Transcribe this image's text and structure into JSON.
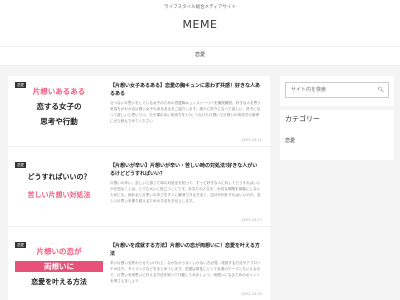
{
  "header": {
    "tagline": "ライフスタイル総合メディアサイト",
    "logo": "MEME"
  },
  "nav": {
    "items": [
      "恋愛"
    ]
  },
  "posts": [
    {
      "category": "恋愛",
      "thumb_lines": [
        "片想いあるある",
        "恋する女子の",
        "思考や行動"
      ],
      "title": "【片想い女子あるある】恋愛の胸キュンに思わず共感！好きな人あるある",
      "snippet": "せつない片思いをしている女子のための恋愛胸キュンストーリーを徹底解説。好きな人を思う気持ちがわかる片想い女子のあるあるをご紹介します。誰かに好きになって欲しい、好きになって欲しいと思いつつ、行き場のない気持ちを1つにつなげた片想いで片想いの気持ちの参考にぜひ読んでみてください",
      "date": "2022.10.22"
    },
    {
      "category": "恋愛",
      "thumb_lines": [
        "どうすればいいの？",
        "苦しい片想い対処法"
      ],
      "title": "【片想いが辛い】片想いが辛い・苦しい時の対処法!好きな人がいるけどどうすればいい？",
      "snippet": "片想いの辛い、苦しいと感じた時の対処法を知って、ずっと好きな人に対してどうすればいいかを知ることは、とても大いに役立つことです。あなたの人生を、大切な時間を無駄にしないためにも、読めると片思いの辛さをすぐに解消できる方法と、自分が何をすればいいのか、苦しい片思いを乗り越えるための方法をお伝えします。",
      "date": "2022.10.17"
    },
    {
      "category": "恋愛",
      "thumb_lines": [
        "片想いの恋が",
        "両想いに",
        "恋愛を叶える方法"
      ],
      "title": "【片想いを成就する方法】片想いの恋が両想いに！恋愛を叶える方法",
      "snippet": "辛い片想いを終わらせたいけれど、なかなかうまくいかない方必見。成就する方法やアプローチの仕方、タイミングなどをまとめています。恋愛は男性にとって永遠のテーマともいえるので、片思いを両思いに叶える方法を知って行動してみましょう。両想いになるためのポイントを押さえましょう",
      "date": "2022.10.15"
    }
  ],
  "sidebar": {
    "search_placeholder": "サイト内を検索",
    "category_heading": "カテゴリー",
    "categories": [
      "恋愛"
    ]
  }
}
